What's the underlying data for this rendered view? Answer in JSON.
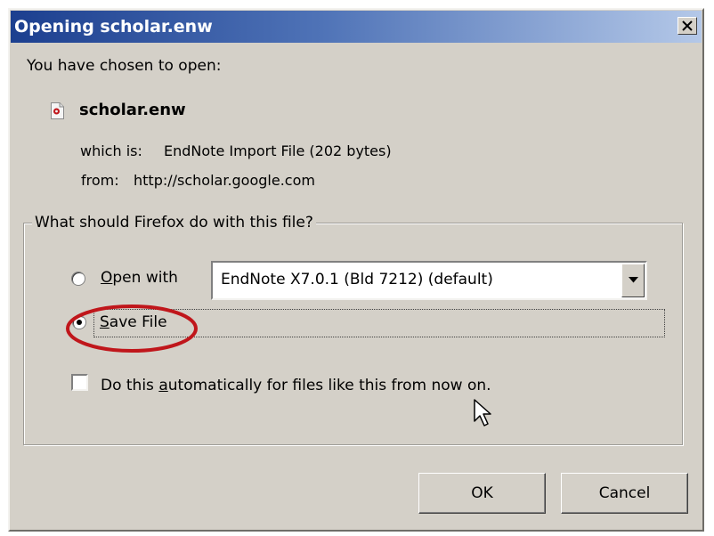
{
  "dialog": {
    "title": "Opening scholar.enw",
    "prompt": "You have chosen to open:",
    "file": {
      "name": "scholar.enw",
      "icon": "endnote-file-icon",
      "which_is_label": "which is:",
      "which_is_value": "EndNote Import File (202 bytes)",
      "from_label": "from:",
      "from_value": "http://scholar.google.com"
    },
    "action_group": {
      "legend": "What should Firefox do with this file?",
      "open_with": {
        "label_accel": "O",
        "label_rest": "pen with",
        "selected": false,
        "application": "EndNote X7.0.1 (Bld 7212) (default)"
      },
      "save_file": {
        "label_accel": "S",
        "label_rest": "ave File",
        "selected": true
      },
      "auto": {
        "label_before": "Do this ",
        "label_accel": "a",
        "label_after": "utomatically for files like this from now on.",
        "checked": false
      }
    },
    "buttons": {
      "ok": "OK",
      "cancel": "Cancel"
    }
  },
  "colors": {
    "title_bar_start": "#1c3f8f",
    "title_bar_end": "#b4c8e8",
    "dialog_bg": "#d4d0c8",
    "annotation_ellipse": "#c0161b"
  }
}
